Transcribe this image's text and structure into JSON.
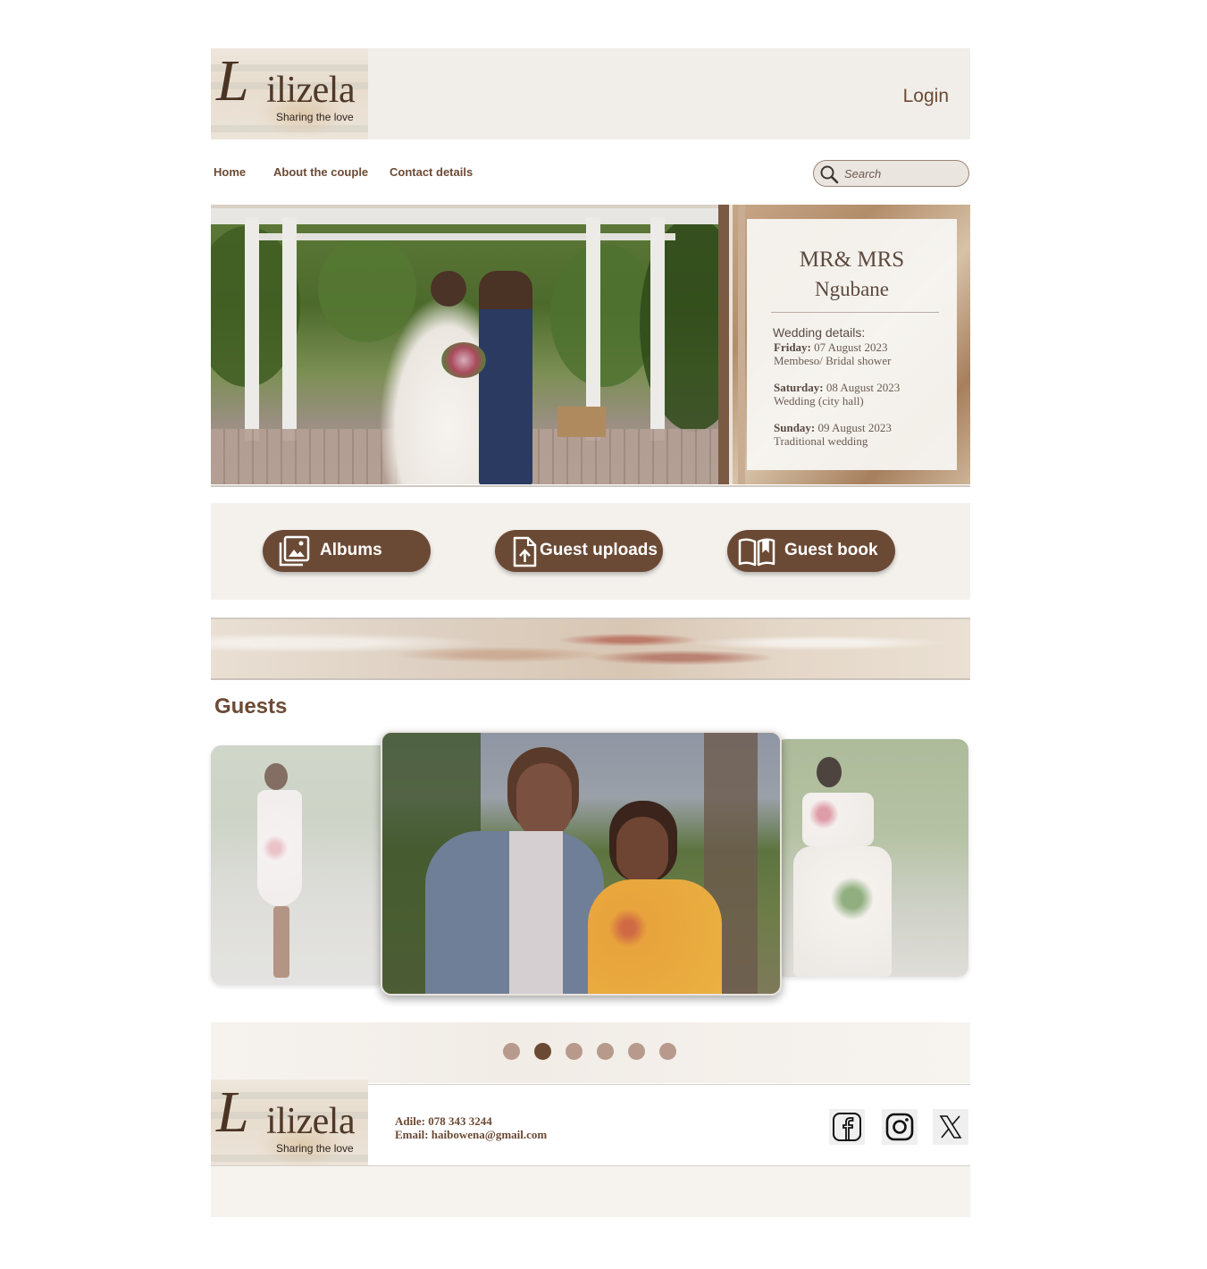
{
  "brand": {
    "initial": "L",
    "name": "ilizela",
    "tagline": "Sharing the love"
  },
  "header": {
    "login_label": "Login"
  },
  "nav": {
    "items": [
      {
        "label": "Home"
      },
      {
        "label": "About the couple"
      },
      {
        "label": "Contact details"
      }
    ]
  },
  "search": {
    "placeholder": "Search",
    "icon": "search-icon"
  },
  "hero": {
    "title_line1": "MR& MRS",
    "title_line2": "Ngubane",
    "details_heading": "Wedding details:",
    "days": [
      {
        "day": "Friday:",
        "date": " 07 August 2023",
        "event": "Membeso/ Bridal shower"
      },
      {
        "day": "Saturday:",
        "date": " 08 August 2023",
        "event": "Wedding (city hall)"
      },
      {
        "day": "Sunday:",
        "date": " 09 August 2023",
        "event": "Traditional wedding"
      }
    ]
  },
  "actions": [
    {
      "label": "Albums",
      "icon": "gallery-icon"
    },
    {
      "label": "Guest uploads",
      "icon": "upload-file-icon"
    },
    {
      "label": "Guest book",
      "icon": "open-book-icon"
    }
  ],
  "guests": {
    "title": "Guests",
    "slide_count": 6,
    "active_slide": 2
  },
  "footer": {
    "phone": "Adile: 078 343 3244",
    "email": "Email: haibowena@gmail.com",
    "social": [
      "facebook-icon",
      "instagram-icon",
      "x-icon"
    ]
  },
  "colors": {
    "brand_brown": "#6b4a35",
    "header_bg": "#f1eeea",
    "dot_inactive": "#b79a8c"
  }
}
